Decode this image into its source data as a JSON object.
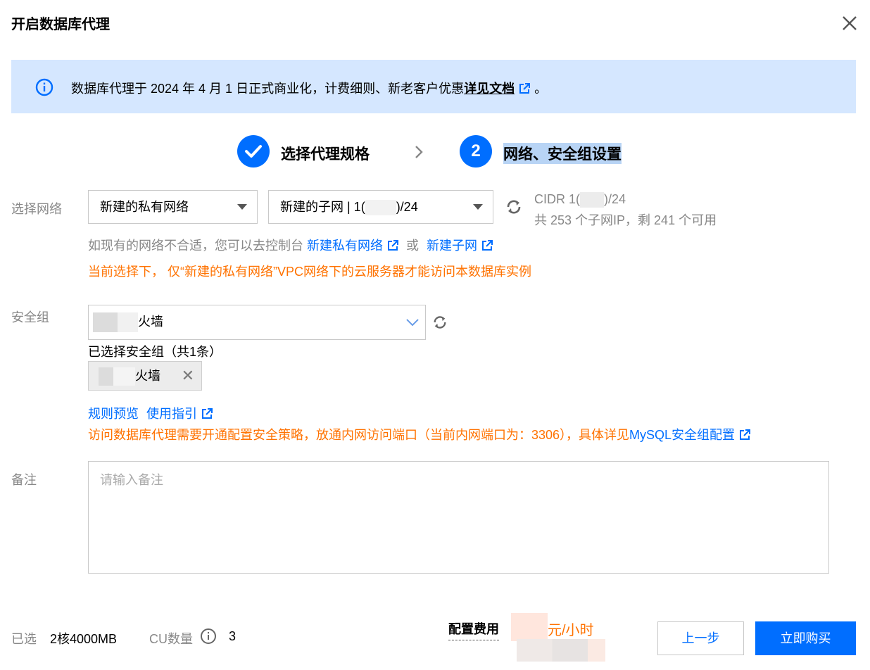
{
  "dialog": {
    "title": "开启数据库代理"
  },
  "notice": {
    "text": "数据库代理于 2024 年 4 月 1 日正式商业化，计费细则、新老客户优惠",
    "link": "详见文档",
    "suffix": "。"
  },
  "steps": [
    {
      "label": "选择代理规格",
      "status": "done"
    },
    {
      "number": "2",
      "label": "网络、安全组设置",
      "status": "active"
    }
  ],
  "network": {
    "label": "选择网络",
    "vpc_select": "新建的私有网络",
    "subnet_select_prefix": "新建的子网 | 1(",
    "subnet_select_suffix": ")/24",
    "cidr_prefix": "CIDR 1(",
    "cidr_suffix": ")/24",
    "ip_info": "共 253 个子网IP，剩 241 个可用",
    "hint_text": "如现有的网络不合适，您可以去控制台",
    "link_vpc": "新建私有网络",
    "or": "或",
    "link_subnet": "新建子网",
    "warning": "当前选择下，  仅“新建的私有网络”VPC网络下的云服务器才能访问本数据库实例"
  },
  "security": {
    "label": "安全组",
    "select_value": "火墙",
    "selected_title": "已选择安全组（共1条）",
    "tag_text": "火墙",
    "link_rules": "规则预览",
    "link_guide": "使用指引",
    "warning_text": "访问数据库代理需要开通配置安全策略，放通内网访问端口（当前内网端口为：3306），具体详见",
    "warning_link": "MySQL安全组配置"
  },
  "remark": {
    "label": "备注",
    "placeholder": "请输入备注"
  },
  "footer": {
    "selected_label": "已选",
    "selected_value": "2核4000MB",
    "cu_label": "CU数量",
    "cu_value": "3",
    "fee_label": "配置费用",
    "fee_unit": "元/小时",
    "prev_button": "上一步",
    "buy_button": "立即购买"
  },
  "colors": {
    "primary": "#006eff",
    "warning": "#ff7200",
    "notice_bg": "#d5e7ff"
  }
}
